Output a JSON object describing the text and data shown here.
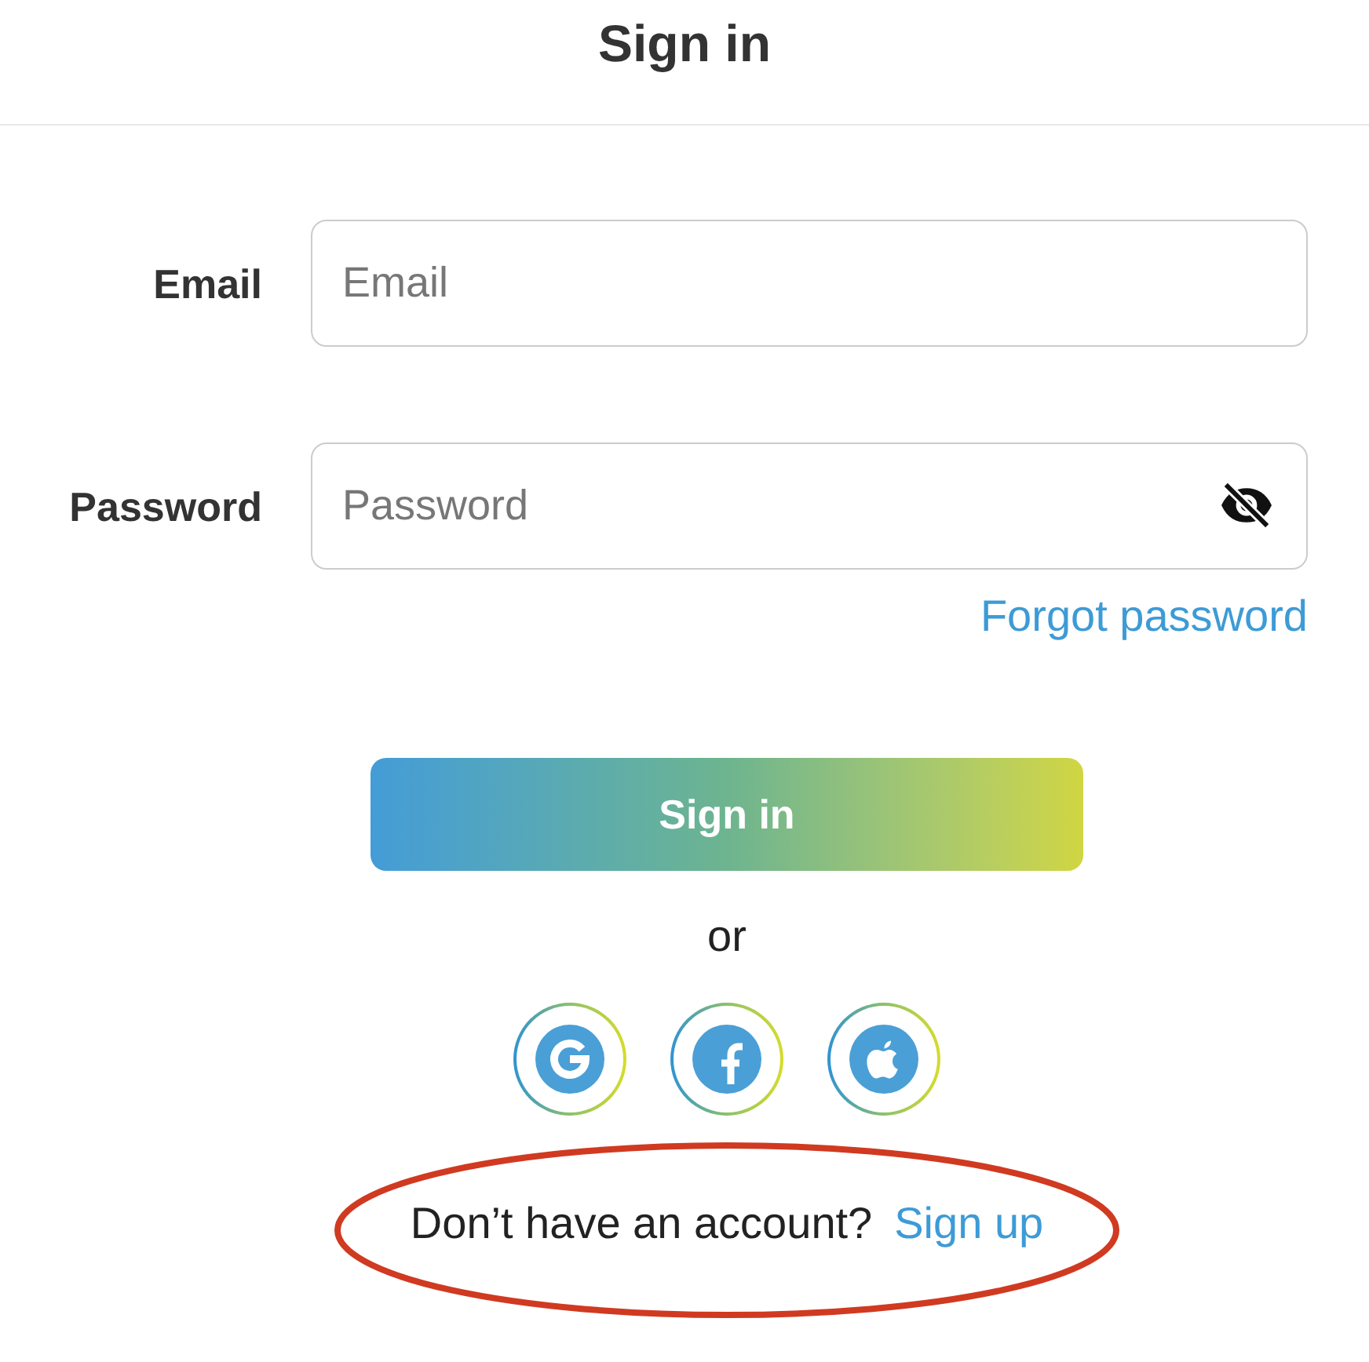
{
  "header": {
    "title": "Sign in"
  },
  "form": {
    "fields": [
      {
        "kind": "email",
        "label": "Email",
        "placeholder": "Email"
      },
      {
        "kind": "password",
        "label": "Password",
        "placeholder": "Password",
        "shown": false
      }
    ],
    "forgot_link": "Forgot password",
    "submit": "Sign in"
  },
  "separator": "or",
  "social_buttons": [
    {
      "kind": "google"
    },
    {
      "kind": "facebook"
    },
    {
      "kind": "apple"
    }
  ],
  "signup": {
    "prompt": "Don’t have an account?",
    "link": "Sign up"
  },
  "annotation": {
    "kind": "ellipse"
  }
}
